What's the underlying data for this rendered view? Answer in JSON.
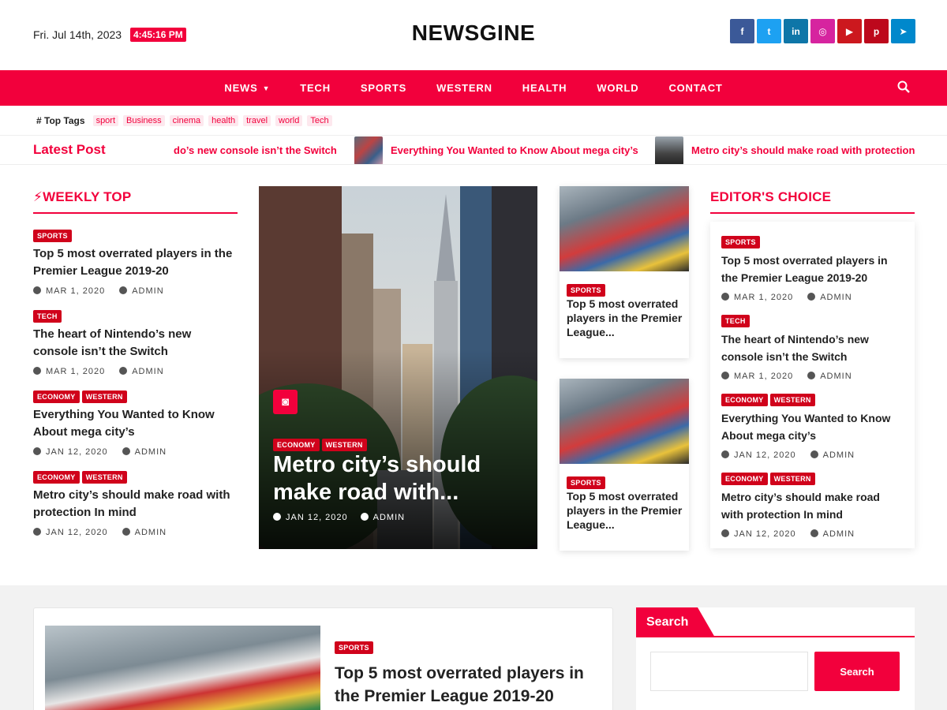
{
  "header": {
    "date": "Fri. Jul 14th, 2023",
    "time": "4:45:16 PM",
    "logo": "NEWSGINE",
    "social": [
      {
        "icon": "facebook-icon",
        "glyph": "f",
        "color": "#3b5998"
      },
      {
        "icon": "twitter-icon",
        "glyph": "t",
        "color": "#1da1f2"
      },
      {
        "icon": "linkedin-icon",
        "glyph": "in",
        "color": "#0e76a8"
      },
      {
        "icon": "instagram-icon",
        "glyph": "◎",
        "color": "#d6249f"
      },
      {
        "icon": "youtube-icon",
        "glyph": "▶",
        "color": "#cc181e"
      },
      {
        "icon": "pinterest-icon",
        "glyph": "p",
        "color": "#bd081c"
      },
      {
        "icon": "telegram-icon",
        "glyph": "➤",
        "color": "#0088cc"
      }
    ]
  },
  "nav": {
    "items": [
      "NEWS",
      "TECH",
      "SPORTS",
      "WESTERN",
      "HEALTH",
      "WORLD",
      "CONTACT"
    ],
    "search_icon": "🔍"
  },
  "tags": {
    "label": "# Top Tags",
    "items": [
      "sport",
      "Business",
      "cinema",
      "health",
      "travel",
      "world",
      "Tech"
    ]
  },
  "latest": {
    "label": "Latest Post",
    "items": [
      "do’s new console isn’t the Switch",
      "Everything You Wanted to Know About mega city’s",
      "Metro city’s should make road with protection"
    ]
  },
  "weekly": {
    "title": "WEEKLY TOP",
    "posts": [
      {
        "badges": [
          "SPORTS"
        ],
        "title": "Top 5 most overrated players in the Premier League 2019-20",
        "date": "MAR 1, 2020",
        "author": "ADMIN"
      },
      {
        "badges": [
          "TECH"
        ],
        "title": "The heart of Nintendo’s new console isn’t the Switch",
        "date": "MAR 1, 2020",
        "author": "ADMIN"
      },
      {
        "badges": [
          "ECONOMY",
          "WESTERN"
        ],
        "title": "Everything You Wanted to Know About mega city’s",
        "date": "JAN 12, 2020",
        "author": "ADMIN"
      },
      {
        "badges": [
          "ECONOMY",
          "WESTERN"
        ],
        "title": "Metro city’s should make road with protection In mind",
        "date": "JAN 12, 2020",
        "author": "ADMIN"
      }
    ]
  },
  "hero": {
    "badges": [
      "ECONOMY",
      "WESTERN"
    ],
    "title": "Metro city’s should make road with...",
    "date": "JAN 12, 2020",
    "author": "ADMIN"
  },
  "cards": [
    {
      "badge": "SPORTS",
      "title": "Top 5 most overrated players in the Premier League..."
    },
    {
      "badge": "SPORTS",
      "title": "Top 5 most overrated players in the Premier League..."
    }
  ],
  "editor": {
    "title": "EDITOR'S CHOICE",
    "posts": [
      {
        "badges": [
          "SPORTS"
        ],
        "title": "Top 5 most overrated players in the Premier League 2019-20",
        "date": "MAR 1, 2020",
        "author": "ADMIN"
      },
      {
        "badges": [
          "TECH"
        ],
        "title": "The heart of Nintendo’s new console isn’t the Switch",
        "date": "MAR 1, 2020",
        "author": "ADMIN"
      },
      {
        "badges": [
          "ECONOMY",
          "WESTERN"
        ],
        "title": "Everything You Wanted to Know About mega city’s",
        "date": "JAN 12, 2020",
        "author": "ADMIN"
      },
      {
        "badges": [
          "ECONOMY",
          "WESTERN"
        ],
        "title": "Metro city’s should make road with protection In mind",
        "date": "JAN 12, 2020",
        "author": "ADMIN"
      }
    ]
  },
  "feature": {
    "badge": "SPORTS",
    "title": "Top 5 most overrated players in the Premier League 2019-20"
  },
  "search_widget": {
    "title": "Search",
    "button": "Search",
    "placeholder": ""
  },
  "colors": {
    "accent": "#f2003c",
    "badge": "#d0021b"
  }
}
